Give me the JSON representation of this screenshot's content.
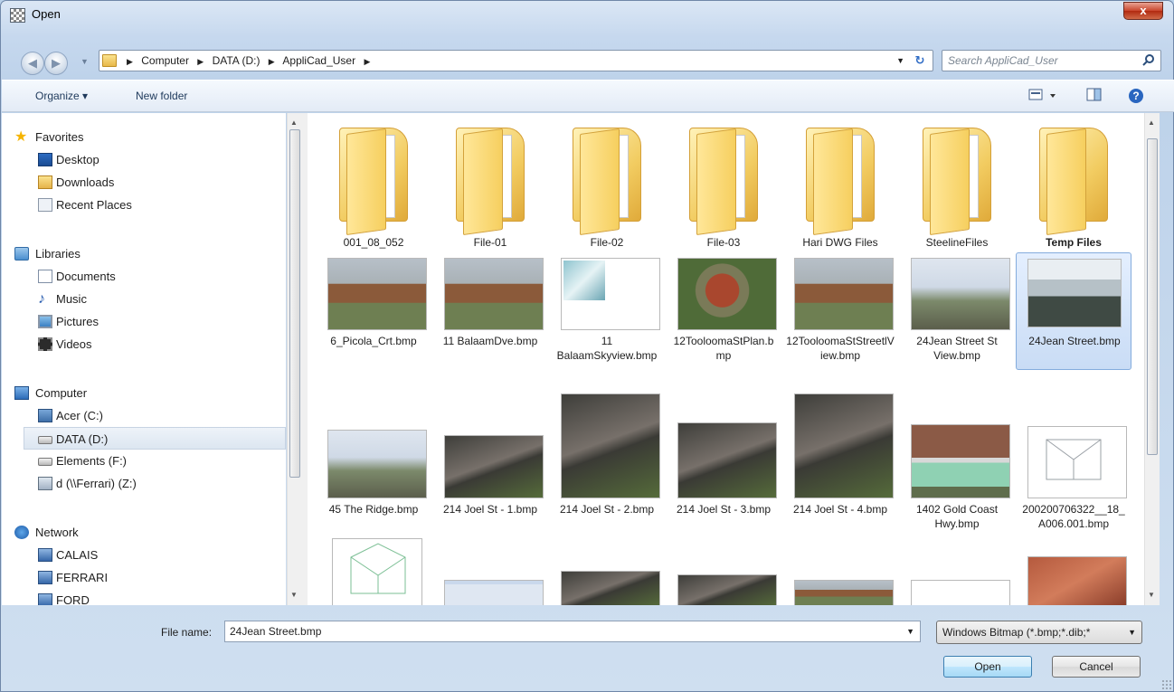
{
  "window": {
    "title": "Open",
    "close_label": "x"
  },
  "nav": {
    "breadcrumb": [
      "Computer",
      "DATA (D:)",
      "AppliCad_User"
    ],
    "search_placeholder": "Search AppliCad_User"
  },
  "toolbar": {
    "organize_label": "Organize ▾",
    "new_folder_label": "New folder"
  },
  "sidebar": {
    "favorites": {
      "label": "Favorites",
      "items": [
        "Desktop",
        "Downloads",
        "Recent Places"
      ]
    },
    "libraries": {
      "label": "Libraries",
      "items": [
        "Documents",
        "Music",
        "Pictures",
        "Videos"
      ]
    },
    "computer": {
      "label": "Computer",
      "items": [
        "Acer (C:)",
        "DATA (D:)",
        "Elements (F:)",
        "d (\\\\Ferrari) (Z:)"
      ]
    },
    "network": {
      "label": "Network",
      "items": [
        "CALAIS",
        "FERRARI",
        "FORD"
      ]
    }
  },
  "files": {
    "row1": [
      "001_08_052",
      "File-01",
      "File-02",
      "File-03",
      "Hari DWG Files",
      "SteelineFiles",
      "Temp Files"
    ],
    "row2": [
      "6_Picola_Crt.bmp",
      "11 BalaamDve.bmp",
      "11 BalaamSkyview.bmp",
      "12TooloomaStPlan.bmp",
      "12TooloomaStStreetlView.bmp",
      "24Jean Street St View.bmp",
      "24Jean Street.bmp"
    ],
    "row3": [
      "45 The Ridge.bmp",
      "214 Joel St - 1.bmp",
      "214 Joel St - 2.bmp",
      "214 Joel St - 3.bmp",
      "214 Joel St - 4.bmp",
      "1402 Gold Coast Hwy.bmp",
      "200200706322__18_A006.001.bmp"
    ]
  },
  "footer": {
    "file_name_label": "File name:",
    "file_name_value": "24Jean Street.bmp",
    "file_type_value": "Windows Bitmap (*.bmp;*.dib;*",
    "open_label": "Open",
    "cancel_label": "Cancel"
  },
  "colors": {
    "selection": "#cde4fb",
    "folder": "#f2cc61",
    "accent": "#2e6bc5"
  }
}
